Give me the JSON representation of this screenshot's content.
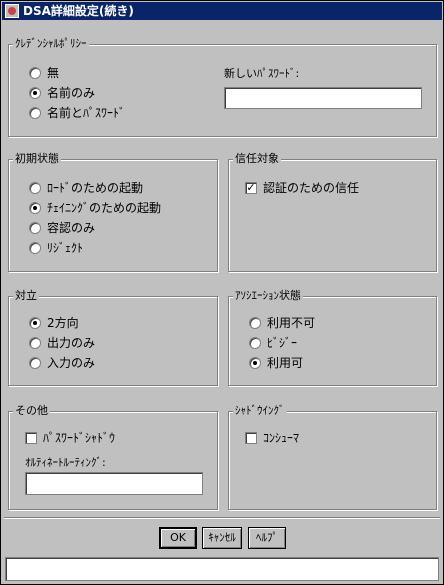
{
  "window": {
    "title": "DSA詳細設定(続き)"
  },
  "credential_policy": {
    "title": "ｸﾚﾃﾞﾝｼｬﾙﾎﾟﾘｼｰ",
    "options": [
      {
        "label": "無",
        "checked": false
      },
      {
        "label": "名前のみ",
        "checked": true
      },
      {
        "label": "名前とﾊﾟｽﾜｰﾄﾞ",
        "checked": false
      }
    ],
    "new_password_label": "新しいﾊﾟｽﾜｰﾄﾞ:",
    "new_password_value": ""
  },
  "initial_state": {
    "title": "初期状態",
    "options": [
      {
        "label": "ﾛｰﾄﾞのための起動",
        "checked": false
      },
      {
        "label": "ﾁｪｲﾆﾝｸﾞのための起動",
        "checked": true
      },
      {
        "label": "容認のみ",
        "checked": false
      },
      {
        "label": "ﾘｼﾞｪｸﾄ",
        "checked": false
      }
    ]
  },
  "trust": {
    "title": "信任対象",
    "options": [
      {
        "label": "認証のための信任",
        "checked": true
      }
    ]
  },
  "opposition": {
    "title": "対立",
    "options": [
      {
        "label": "2方向",
        "checked": true
      },
      {
        "label": "出力のみ",
        "checked": false
      },
      {
        "label": "入力のみ",
        "checked": false
      }
    ]
  },
  "association_state": {
    "title": "ｱｿｼｴｰｼｮﾝ状態",
    "options": [
      {
        "label": "利用不可",
        "checked": false
      },
      {
        "label": "ﾋﾞｼﾞｰ",
        "checked": false
      },
      {
        "label": "利用可",
        "checked": true
      }
    ]
  },
  "other": {
    "title": "その他",
    "password_shadow_label": "ﾊﾟｽﾜｰﾄﾞｼｬﾄﾞｳ",
    "password_shadow_checked": false,
    "alt_routing_label": "ｵﾙﾃｨﾈｰﾄﾙｰﾃｨﾝｸﾞ:",
    "alt_routing_value": ""
  },
  "shadowing": {
    "title": "ｼｬﾄﾞｳｲﾝｸﾞ",
    "consumer_label": "ｺﾝｼｭｰﾏ",
    "consumer_checked": false
  },
  "buttons": {
    "ok": "OK",
    "cancel": "ｷｬﾝｾﾙ",
    "help": "ﾍﾙﾌﾟ"
  },
  "status": {
    "text": ""
  }
}
